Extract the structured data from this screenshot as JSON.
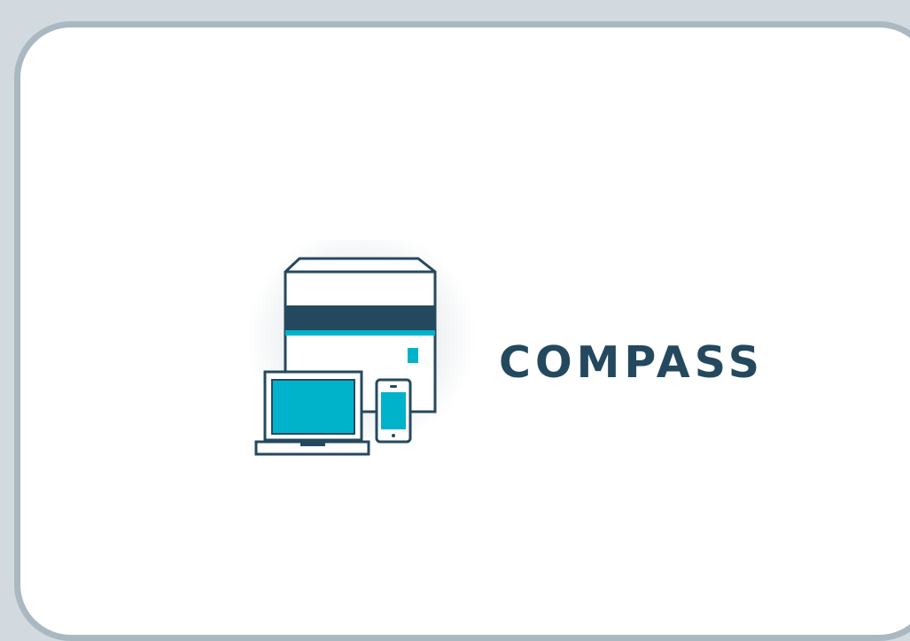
{
  "app": {
    "brand_name": "COMPASS",
    "logo_icon": "server-laptop-phone-icon"
  },
  "colors": {
    "background": "#d3dadf",
    "frame_border": "#a9b8c1",
    "panel": "#ffffff",
    "navy": "#24495e",
    "teal": "#00b3cb"
  }
}
